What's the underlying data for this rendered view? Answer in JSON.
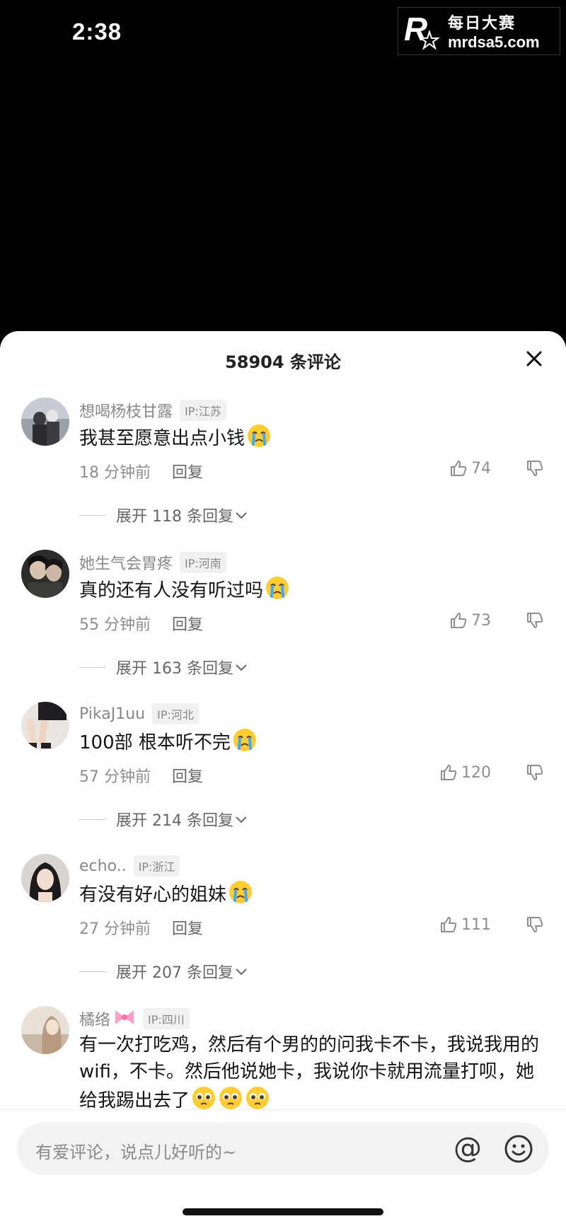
{
  "status_bar": {
    "time": "2:38"
  },
  "watermark": {
    "brand": "每日大赛",
    "url": "mrdsa5.com"
  },
  "sheet": {
    "title": "58904 条评论"
  },
  "comments": [
    {
      "name": "想喝杨枝甘露",
      "ip": "IP:江苏",
      "text": "我甚至愿意出点小钱",
      "time": "18 分钟前",
      "reply": "回复",
      "likes": "74",
      "expand": "展开 118 条回复"
    },
    {
      "name": "她生气会胃疼",
      "ip": "IP:河南",
      "text": "真的还有人没有听过吗",
      "time": "55 分钟前",
      "reply": "回复",
      "likes": "73",
      "expand": "展开 163 条回复"
    },
    {
      "name": "PikaJ1uu",
      "ip": "IP:河北",
      "text": "100部 根本听不完",
      "time": "57 分钟前",
      "reply": "回复",
      "likes": "120",
      "expand": "展开 214 条回复"
    },
    {
      "name": "echo..",
      "ip": "IP:浙江",
      "text": "有没有好心的姐妹",
      "time": "27 分钟前",
      "reply": "回复",
      "likes": "111",
      "expand": "展开 207 条回复"
    },
    {
      "name": "橘络",
      "ip": "IP:四川",
      "text": "有一次打吃鸡，然后有个男的的问我卡不卡，我说我用的wifi，不卡。然后他说她卡，我说你卡就用流量打呗，她给我踢出去了"
    }
  ],
  "input": {
    "placeholder": "有爱评论，说点儿好听的~",
    "at_symbol": "@"
  },
  "colors": {
    "background": "#000000",
    "sheet": "#ffffff",
    "muted": "#8e8e8e",
    "input_bg": "#f2f2f4"
  }
}
